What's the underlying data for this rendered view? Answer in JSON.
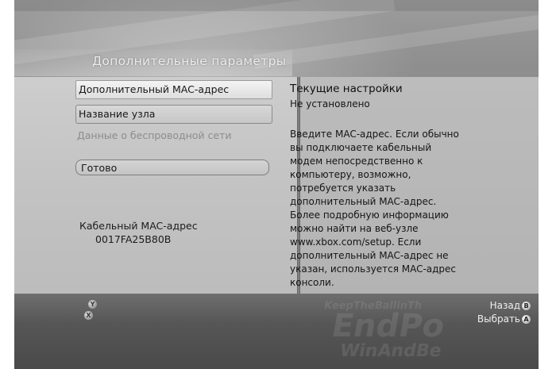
{
  "page_title": "Дополнительные параметры",
  "menu": {
    "items": [
      {
        "label": "Дополнительный MAC-адрес",
        "state": "selected"
      },
      {
        "label": "Название узла",
        "state": "normal"
      },
      {
        "label": "Данные о беспроводной сети",
        "state": "disabled"
      }
    ],
    "done_label": "Готово"
  },
  "mac_info": {
    "label": "Кабельный MAC-адрес",
    "value": "0017FA25B80B"
  },
  "details": {
    "heading": "Текущие настройки",
    "current_value": "Не установлено",
    "help_text": "Введите MAC-адрес. Если обычно\nвы подключаете кабельный\nмодем непосредственно к\nкомпьютеру, возможно,\nпотребуется указать\nдополнительный MAC-адрес.\nБолее подробную информацию\nможно найти на веб-узле\nwww.xbox.com/setup. Если\nдополнительный MAC-адрес не\nуказан, используется MAC-адрес\nконсоли."
  },
  "footer": {
    "back_label": "Назад",
    "back_button": "B",
    "select_label": "Выбрать",
    "select_button": "A",
    "y_button": "Y",
    "x_button": "X"
  },
  "watermark": {
    "line1": "KeepTheBallinTh",
    "line2": "EndPo",
    "line3": "WinAndBe"
  },
  "colors": {
    "back_button": "#c83232",
    "select_button": "#3a9a3a",
    "y_button": "#c8a000",
    "x_button": "#2f5fbf"
  }
}
